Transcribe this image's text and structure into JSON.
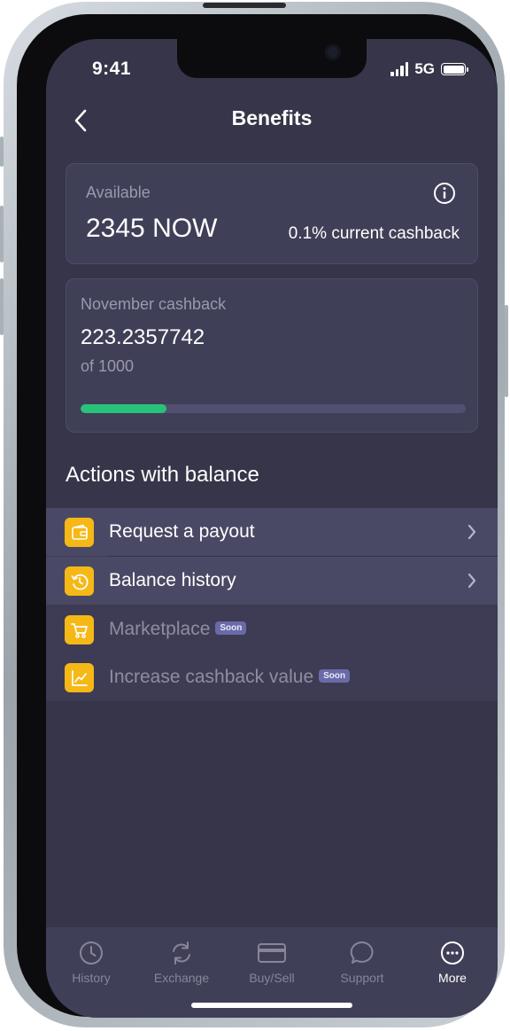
{
  "status_bar": {
    "time": "9:41",
    "network": "5G"
  },
  "header": {
    "title": "Benefits",
    "back_icon": "chevron-left-icon"
  },
  "available_card": {
    "label": "Available",
    "balance": "2345 NOW",
    "cashback_rate": "0.1% current cashback",
    "info_icon": "info-icon"
  },
  "monthly_card": {
    "label": "November cashback",
    "amount": "223.2357742",
    "limit": "of 1000",
    "progress_fraction": 0.2232,
    "progress_color": "#27c37a"
  },
  "actions": {
    "title": "Actions with balance",
    "items": [
      {
        "label": "Request a payout",
        "icon": "wallet-icon",
        "badge": "",
        "enabled": true
      },
      {
        "label": "Balance history",
        "icon": "history-icon",
        "badge": "",
        "enabled": true
      },
      {
        "label": "Marketplace",
        "icon": "cart-icon",
        "badge": "Soon",
        "enabled": false
      },
      {
        "label": "Increase cashback value",
        "icon": "chart-icon",
        "badge": "Soon",
        "enabled": false
      }
    ]
  },
  "tab_bar": {
    "tabs": [
      {
        "label": "History",
        "icon": "clock-icon",
        "active": false
      },
      {
        "label": "Exchange",
        "icon": "exchange-icon",
        "active": false
      },
      {
        "label": "Buy/Sell",
        "icon": "card-icon",
        "active": false
      },
      {
        "label": "Support",
        "icon": "chat-icon",
        "active": false
      },
      {
        "label": "More",
        "icon": "more-icon",
        "active": true
      }
    ]
  },
  "colors": {
    "accent_icon_bg": "#f5b816",
    "background": "#363549",
    "card": "#403f58",
    "soon_badge": "#6b6aa8"
  }
}
